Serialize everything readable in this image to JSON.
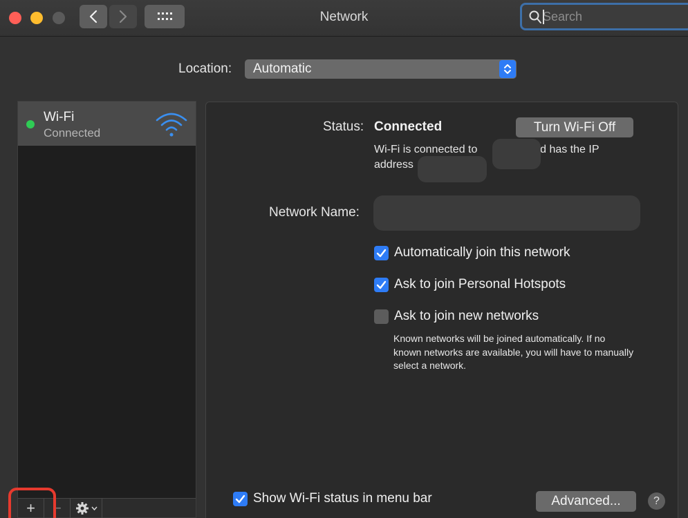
{
  "window": {
    "title": "Network"
  },
  "toolbar": {
    "back": "back",
    "forward": "forward",
    "grid": "show-all"
  },
  "search": {
    "placeholder": "Search",
    "value": ""
  },
  "location": {
    "label": "Location:",
    "value": "Automatic"
  },
  "sidebar": {
    "services": [
      {
        "name": "Wi-Fi",
        "status": "Connected",
        "status_color": "#2fcc55"
      }
    ],
    "toolbar": {
      "add": "+",
      "remove": "−"
    }
  },
  "detail": {
    "status_label": "Status:",
    "status_value": "Connected",
    "turn_off_label": "Turn Wi-Fi Off",
    "desc_part1": "Wi-Fi is connected to",
    "desc_part2": "and has the IP address",
    "network_name_label": "Network Name:",
    "options": [
      {
        "label": "Automatically join this network",
        "checked": true
      },
      {
        "label": "Ask to join Personal Hotspots",
        "checked": true
      },
      {
        "label": "Ask to join new networks",
        "checked": false
      }
    ],
    "hint": "Known networks will be joined automatically. If no known networks are available, you will have to manually select a network.",
    "show_status_label": "Show Wi-Fi status in menu bar",
    "advanced_label": "Advanced...",
    "help_label": "?"
  },
  "colors": {
    "accent": "#2e7cf6",
    "highlight": "#e63a2e",
    "connected": "#2fcc55"
  }
}
